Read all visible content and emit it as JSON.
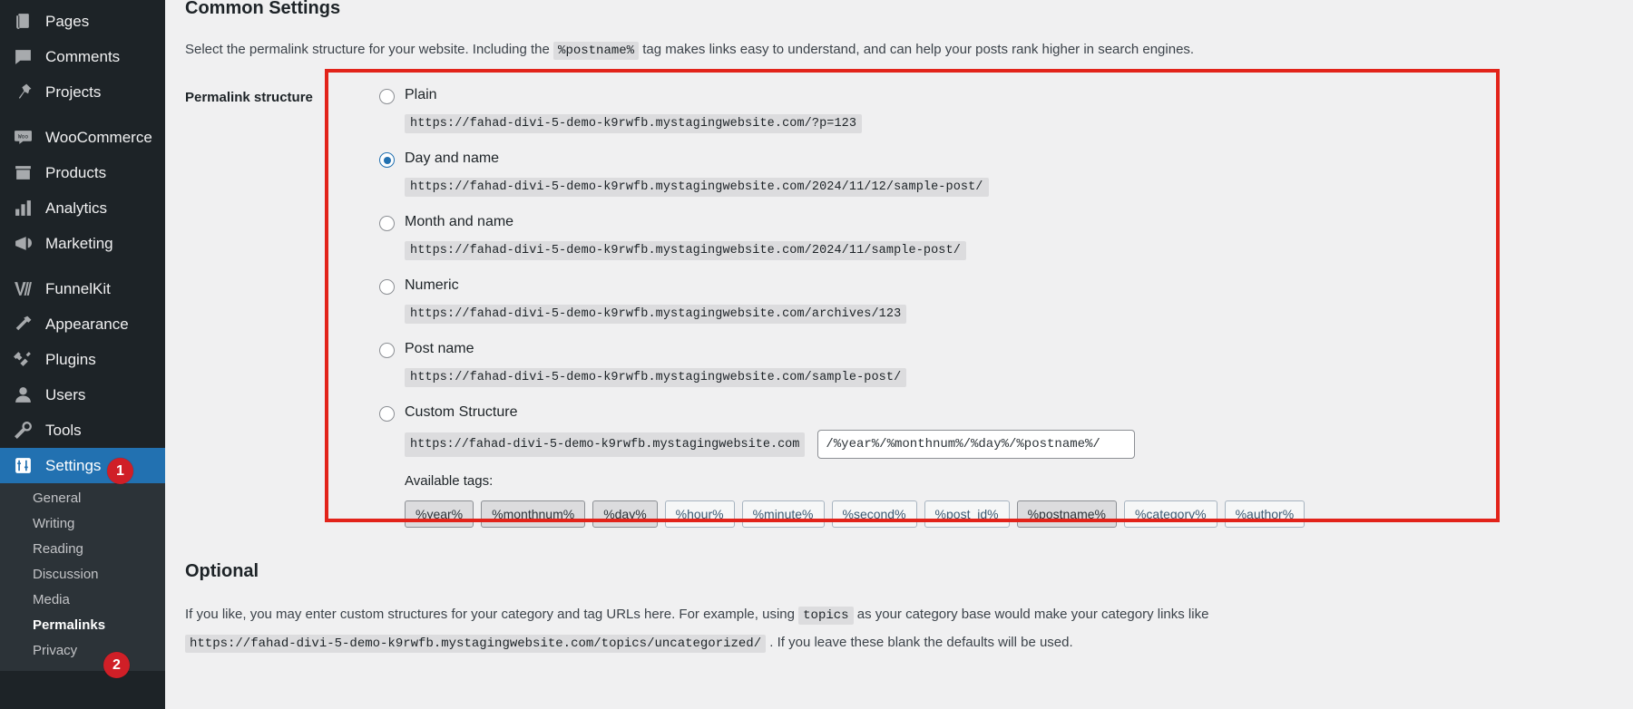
{
  "sidebar": {
    "items": [
      {
        "label": "Pages",
        "icon": "pages-icon"
      },
      {
        "label": "Comments",
        "icon": "comments-icon"
      },
      {
        "label": "Projects",
        "icon": "pin-icon"
      },
      {
        "label": "WooCommerce",
        "icon": "woocommerce-icon"
      },
      {
        "label": "Products",
        "icon": "products-icon"
      },
      {
        "label": "Analytics",
        "icon": "analytics-icon"
      },
      {
        "label": "Marketing",
        "icon": "megaphone-icon"
      },
      {
        "label": "FunnelKit",
        "icon": "funnelkit-icon"
      },
      {
        "label": "Appearance",
        "icon": "appearance-icon"
      },
      {
        "label": "Plugins",
        "icon": "plugins-icon"
      },
      {
        "label": "Users",
        "icon": "users-icon"
      },
      {
        "label": "Tools",
        "icon": "tools-icon"
      },
      {
        "label": "Settings",
        "icon": "settings-icon"
      }
    ],
    "submenu": [
      {
        "label": "General"
      },
      {
        "label": "Writing"
      },
      {
        "label": "Reading"
      },
      {
        "label": "Discussion"
      },
      {
        "label": "Media"
      },
      {
        "label": "Permalinks"
      },
      {
        "label": "Privacy"
      }
    ],
    "badges": {
      "settings": "1",
      "permalinks": "2"
    },
    "accent_active": "#2271b1",
    "badge_color": "#d01f27"
  },
  "main": {
    "section_title": "Common Settings",
    "description_part1": "Select the permalink structure for your website. Including the ",
    "description_code": "%postname%",
    "description_part2": " tag makes links easy to understand, and can help your posts rank higher in search engines.",
    "form_label": "Permalink structure",
    "options": [
      {
        "label": "Plain",
        "url": "https://fahad-divi-5-demo-k9rwfb.mystagingwebsite.com/?p=123",
        "selected": false
      },
      {
        "label": "Day and name",
        "url": "https://fahad-divi-5-demo-k9rwfb.mystagingwebsite.com/2024/11/12/sample-post/",
        "selected": true
      },
      {
        "label": "Month and name",
        "url": "https://fahad-divi-5-demo-k9rwfb.mystagingwebsite.com/2024/11/sample-post/",
        "selected": false
      },
      {
        "label": "Numeric",
        "url": "https://fahad-divi-5-demo-k9rwfb.mystagingwebsite.com/archives/123",
        "selected": false
      },
      {
        "label": "Post name",
        "url": "https://fahad-divi-5-demo-k9rwfb.mystagingwebsite.com/sample-post/",
        "selected": false
      }
    ],
    "custom": {
      "label": "Custom Structure",
      "selected": false,
      "prefix": "https://fahad-divi-5-demo-k9rwfb.mystagingwebsite.com",
      "input_value": "/%year%/%monthnum%/%day%/%postname%/",
      "available_tags_label": "Available tags:",
      "tags": [
        {
          "label": "%year%",
          "used": true
        },
        {
          "label": "%monthnum%",
          "used": true
        },
        {
          "label": "%day%",
          "used": true
        },
        {
          "label": "%hour%",
          "used": false
        },
        {
          "label": "%minute%",
          "used": false
        },
        {
          "label": "%second%",
          "used": false
        },
        {
          "label": "%post_id%",
          "used": false
        },
        {
          "label": "%postname%",
          "used": true
        },
        {
          "label": "%category%",
          "used": false
        },
        {
          "label": "%author%",
          "used": false
        }
      ]
    },
    "optional": {
      "title": "Optional",
      "text_part1": "If you like, you may enter custom structures for your category and tag URLs here. For example, using ",
      "code1": "topics",
      "text_part2": " as your category base would make your category links like ",
      "code2": "https://fahad-divi-5-demo-k9rwfb.mystagingwebsite.com/topics/uncategorized/",
      "text_part3": " . If you leave these blank the defaults will be used."
    },
    "highlight_color": "#e2231a"
  }
}
